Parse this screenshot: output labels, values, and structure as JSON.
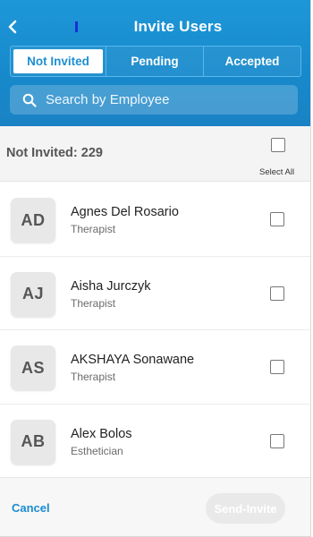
{
  "header": {
    "title": "Invite Users",
    "back_icon": "chevron-left-icon",
    "accent_color": "#1d97d8"
  },
  "tabs": [
    {
      "label": "Not Invited",
      "active": true
    },
    {
      "label": "Pending",
      "active": false
    },
    {
      "label": "Accepted",
      "active": false
    }
  ],
  "search": {
    "icon": "search-icon",
    "placeholder": "Search by Employee",
    "value": ""
  },
  "summary": {
    "label": "Not Invited:  229",
    "select_all_label": "Select All"
  },
  "users": [
    {
      "initials": "AD",
      "name": "Agnes Del Rosario",
      "role": "Therapist",
      "checked": false
    },
    {
      "initials": "AJ",
      "name": "Aisha Jurczyk",
      "role": "Therapist",
      "checked": false
    },
    {
      "initials": "AS",
      "name": "AKSHAYA Sonawane",
      "role": "Therapist",
      "checked": false
    },
    {
      "initials": "AB",
      "name": "Alex Bolos",
      "role": "Esthetician",
      "checked": false
    }
  ],
  "footer": {
    "cancel_label": "Cancel",
    "send_label": "Send-Invite",
    "send_enabled": false
  }
}
